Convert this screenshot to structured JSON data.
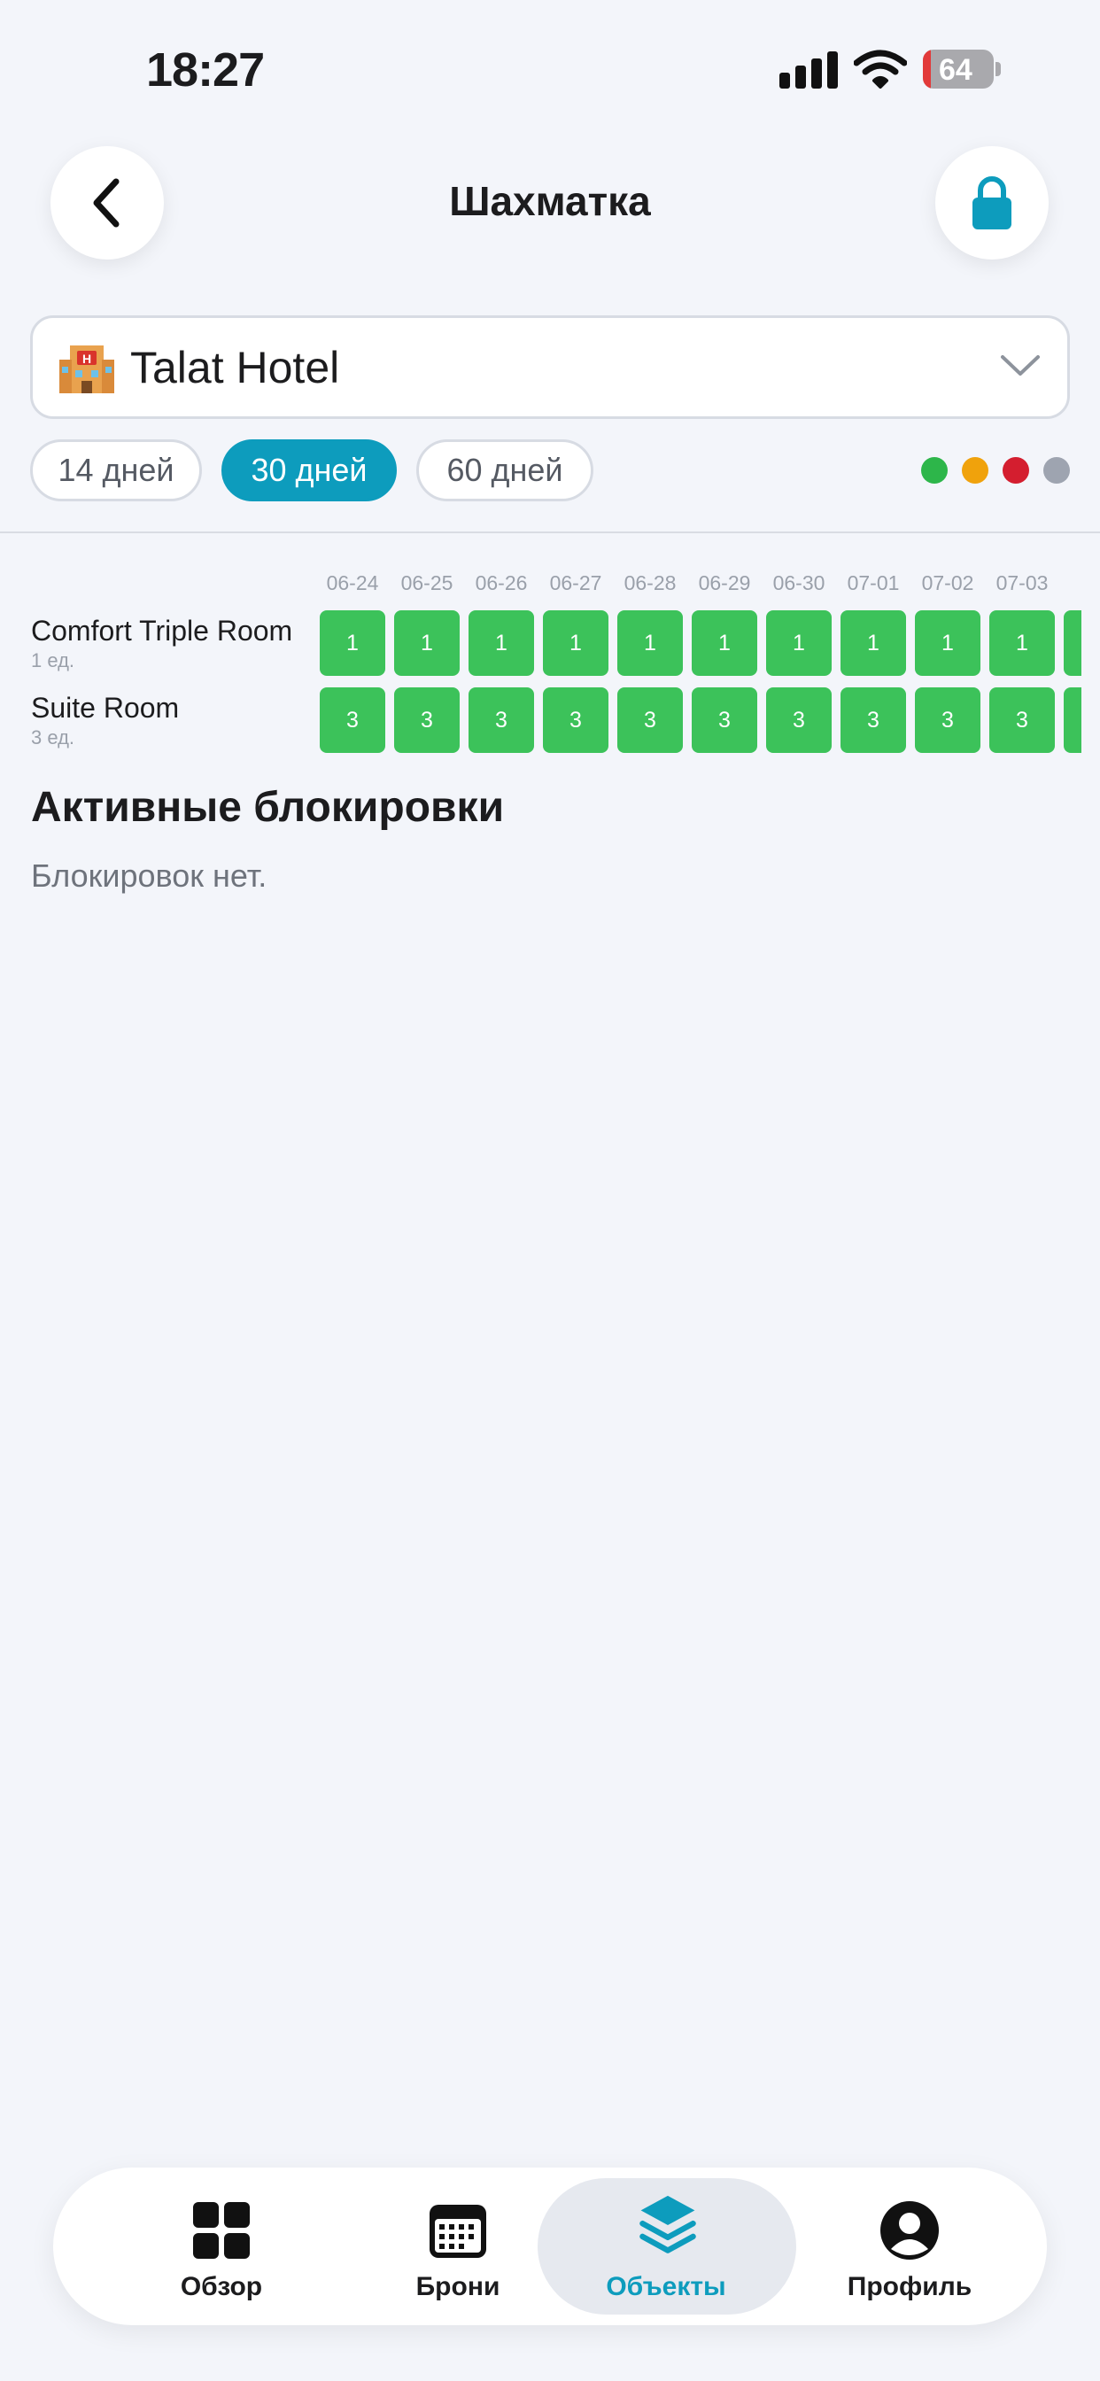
{
  "status_bar": {
    "time": "18:27",
    "battery": "64"
  },
  "header": {
    "title": "Шахматка",
    "back_icon": "chevron-left-icon",
    "lock_icon": "lock-icon",
    "accent_color": "#0d9cbd"
  },
  "hotel_select": {
    "emoji_icon": "hotel-icon",
    "value": "Talat Hotel"
  },
  "periods": [
    {
      "label": "14 дней",
      "active": false
    },
    {
      "label": "30 дней",
      "active": true
    },
    {
      "label": "60 дней",
      "active": false
    }
  ],
  "legend_colors": [
    "#2db64a",
    "#f0a20c",
    "#d41e2f",
    "#9ea4b0"
  ],
  "grid": {
    "dates": [
      "06-24",
      "06-25",
      "06-26",
      "06-27",
      "06-28",
      "06-29",
      "06-30",
      "07-01",
      "07-02",
      "07-03"
    ],
    "rooms": [
      {
        "name": "Comfort Triple Room",
        "units": "1 ед.",
        "availability": [
          "1",
          "1",
          "1",
          "1",
          "1",
          "1",
          "1",
          "1",
          "1",
          "1"
        ]
      },
      {
        "name": "Suite Room",
        "units": "3 ед.",
        "availability": [
          "3",
          "3",
          "3",
          "3",
          "3",
          "3",
          "3",
          "3",
          "3",
          "3"
        ]
      }
    ],
    "available_color": "#3cc25a"
  },
  "blocks": {
    "title": "Активные блокировки",
    "empty_text": "Блокировок нет."
  },
  "nav": [
    {
      "label": "Обзор",
      "icon": "grid-icon",
      "active": false
    },
    {
      "label": "Брони",
      "icon": "calendar-icon",
      "active": false
    },
    {
      "label": "Объекты",
      "icon": "layers-icon",
      "active": true
    },
    {
      "label": "Профиль",
      "icon": "profile-icon",
      "active": false
    }
  ]
}
